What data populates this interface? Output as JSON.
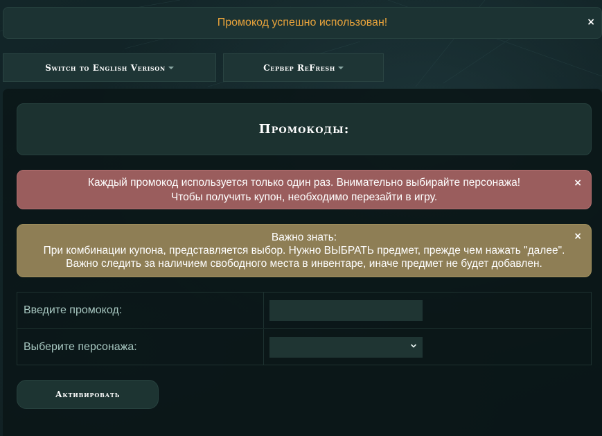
{
  "toast": {
    "message": "Промокод успешно использован!",
    "close_icon": "×"
  },
  "top_buttons": {
    "language_label": "Switch to English Verison",
    "server_label": "Сервер ReFresh"
  },
  "heading": "Промокоды:",
  "alerts": {
    "red": {
      "line1": "Каждый промокод используется только один раз. Внимательно выбирайте персонажа!",
      "line2": "Чтобы получить купон, необходимо перезайти в игру.",
      "close_icon": "×"
    },
    "gold": {
      "line1": "Важно знать:",
      "line2": "При комбинации купона, представляется выбор. Нужно ВЫБРАТЬ предмет, прежде чем нажать \"далее\".",
      "line3": "Важно следить за наличием свободного места в инвентаре, иначе предмет не будет добавлен.",
      "close_icon": "×"
    }
  },
  "form": {
    "promo_label": "Введите промокод:",
    "promo_value": "",
    "character_label": "Выберите персонажа:",
    "character_selected": ""
  },
  "activate_label": "Активировать",
  "colors": {
    "toast_text": "#e8a33b",
    "alert_red": "#9a5d5d",
    "alert_gold": "#8e7e55",
    "panel": "#1c3230"
  },
  "icons": {
    "dropdown_caret": "caret-down-icon",
    "select_chevron": "chevron-down-icon",
    "close": "close-icon"
  }
}
